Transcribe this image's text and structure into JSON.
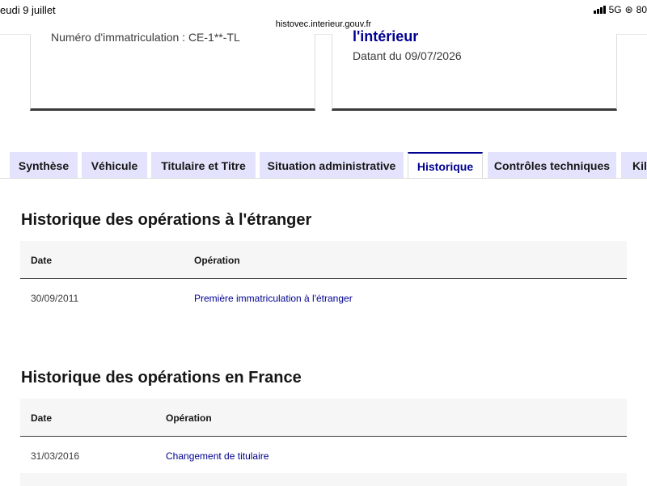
{
  "status": {
    "date": "eudi 9 juillet",
    "url": "histovec.interieur.gouv.fr",
    "network": "5G",
    "battery": "80"
  },
  "cards": {
    "left_text": "Numéro d'immatriculation : CE-1**-TL",
    "right_title": "l'intérieur",
    "right_text": "Datant du 09/07/2026"
  },
  "tabs": [
    {
      "label": "Synthèse"
    },
    {
      "label": "Véhicule"
    },
    {
      "label": "Titulaire et Titre"
    },
    {
      "label": "Situation administrative"
    },
    {
      "label": "Historique"
    },
    {
      "label": "Contrôles techniques"
    },
    {
      "label": "Kilo"
    }
  ],
  "active_tab": "Historique",
  "foreign": {
    "title": "Historique des opérations à l'étranger",
    "columns": [
      "Date",
      "Opération"
    ],
    "rows": [
      {
        "date": "30/09/2011",
        "operation": "Première immatriculation à l'étranger"
      }
    ]
  },
  "france": {
    "title": "Historique des opérations en France",
    "columns": [
      "Date",
      "Opération"
    ],
    "rows": [
      {
        "date": "31/03/2016",
        "operation": "Changement de titulaire"
      }
    ]
  },
  "colors": {
    "accent": "#000091",
    "tab_bg": "#e3e3fd",
    "header_bg": "#f6f6f6"
  }
}
